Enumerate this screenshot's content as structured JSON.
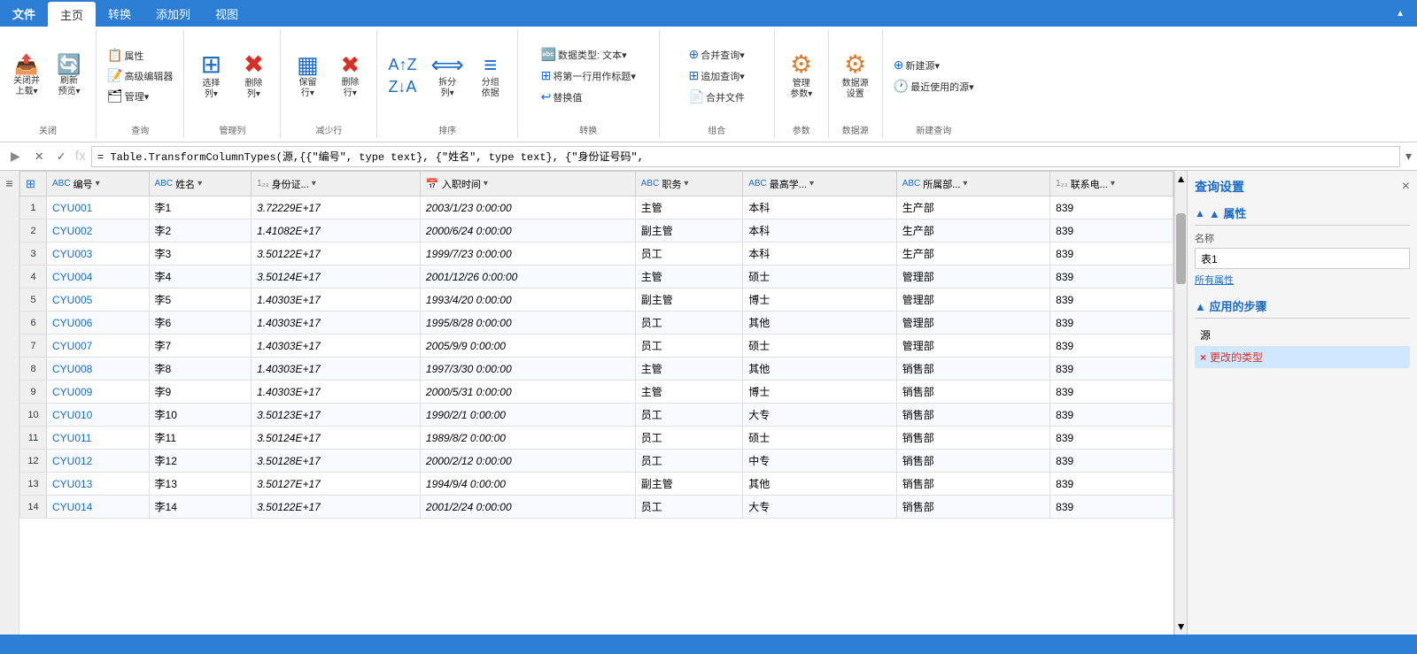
{
  "tabs": {
    "file": "文件",
    "home": "主页",
    "transform": "转换",
    "add_col": "添加列",
    "view": "视图"
  },
  "ribbon": {
    "groups": [
      {
        "name": "close_group",
        "label": "关闭",
        "items": [
          {
            "id": "close_load",
            "icon": "📤",
            "label": "关闭并\n上载▾",
            "type": "big"
          },
          {
            "id": "refresh",
            "icon": "🔄",
            "label": "刷新\n预览▾",
            "type": "big"
          }
        ]
      },
      {
        "name": "query_group",
        "label": "查询",
        "items": [
          {
            "id": "properties",
            "icon": "📋",
            "label": "属性",
            "type": "small"
          },
          {
            "id": "advanced_editor",
            "icon": "📝",
            "label": "高级编辑器",
            "type": "small"
          },
          {
            "id": "manage",
            "icon": "🗂",
            "label": "管理▾",
            "type": "small"
          }
        ]
      },
      {
        "name": "manage_col_group",
        "label": "管理列",
        "items": [
          {
            "id": "select_col",
            "icon": "☑",
            "label": "选择\n列▾",
            "type": "big"
          },
          {
            "id": "delete_col",
            "icon": "✖",
            "label": "删除\n列▾",
            "type": "big"
          }
        ]
      },
      {
        "name": "reduce_row_group",
        "label": "减少行",
        "items": [
          {
            "id": "keep_row",
            "icon": "▦",
            "label": "保留\n行▾",
            "type": "big"
          },
          {
            "id": "remove_row",
            "icon": "✖",
            "label": "删除\n行▾",
            "type": "big"
          }
        ]
      },
      {
        "name": "sort_group",
        "label": "排序",
        "items": [
          {
            "id": "sort_asc",
            "icon": "↑",
            "label": "",
            "type": "sort"
          },
          {
            "id": "sort_desc",
            "icon": "↓",
            "label": "",
            "type": "sort"
          },
          {
            "id": "split_col",
            "icon": "⟺",
            "label": "拆分\n列▾",
            "type": "big"
          },
          {
            "id": "group_by",
            "icon": "≡",
            "label": "分组\n依据",
            "type": "big"
          }
        ]
      },
      {
        "name": "transform_group",
        "label": "转换",
        "items": [
          {
            "id": "data_type",
            "icon": "🔤",
            "label": "数据类型: 文本▾",
            "type": "wide"
          },
          {
            "id": "first_row_header",
            "icon": "⊞",
            "label": "将第一行用作标题▾",
            "type": "wide"
          },
          {
            "id": "replace_value",
            "icon": "↩",
            "label": "替换值",
            "type": "wide"
          }
        ]
      },
      {
        "name": "combine_group",
        "label": "组合",
        "items": [
          {
            "id": "merge_query",
            "icon": "⊕",
            "label": "合并查询▾",
            "type": "wide"
          },
          {
            "id": "append_query",
            "icon": "⊞",
            "label": "追加查询▾",
            "type": "wide"
          },
          {
            "id": "merge_file",
            "icon": "📄",
            "label": "合并文件",
            "type": "wide"
          }
        ]
      },
      {
        "name": "params_group",
        "label": "参数",
        "items": [
          {
            "id": "manage_params",
            "icon": "⚙",
            "label": "管理\n参数▾",
            "type": "big"
          }
        ]
      },
      {
        "name": "datasource_group",
        "label": "数据源",
        "items": [
          {
            "id": "datasource_settings",
            "icon": "⚙",
            "label": "数据源\n设置",
            "type": "big"
          }
        ]
      },
      {
        "name": "new_query_group",
        "label": "新建查询",
        "items": [
          {
            "id": "new_source",
            "icon": "⊕",
            "label": "新建源▾",
            "type": "wide"
          },
          {
            "id": "recent_source",
            "icon": "🕐",
            "label": "最近使用的源▾",
            "type": "wide"
          }
        ]
      }
    ]
  },
  "formula_bar": {
    "cancel_icon": "✕",
    "confirm_icon": "✓",
    "fx_label": "fx",
    "formula": "= Table.TransformColumnTypes(源,{{\"编号\", type text}, {\"姓名\", type text}, {\"身份证号码\","
  },
  "table": {
    "columns": [
      {
        "id": "row_num",
        "label": "",
        "type": ""
      },
      {
        "id": "num",
        "label": "编号",
        "type": "ABC"
      },
      {
        "id": "name",
        "label": "姓名",
        "type": "ABC"
      },
      {
        "id": "id_card",
        "label": "身份证...",
        "type": "123"
      },
      {
        "id": "entry_time",
        "label": "入职时间",
        "type": "CAL"
      },
      {
        "id": "position",
        "label": "职务",
        "type": "ABC"
      },
      {
        "id": "education",
        "label": "最高学...",
        "type": "ABC"
      },
      {
        "id": "department",
        "label": "所属部...",
        "type": "ABC"
      },
      {
        "id": "phone",
        "label": "联系电...",
        "type": "123"
      }
    ],
    "rows": [
      {
        "row": 1,
        "num": "CYU001",
        "name": "李1",
        "id_card": "3.72229E+17",
        "entry_time": "2003/1/23 0:00:00",
        "position": "主管",
        "education": "本科",
        "department": "生产部",
        "phone": "839"
      },
      {
        "row": 2,
        "num": "CYU002",
        "name": "李2",
        "id_card": "1.41082E+17",
        "entry_time": "2000/6/24 0:00:00",
        "position": "副主管",
        "education": "本科",
        "department": "生产部",
        "phone": "839"
      },
      {
        "row": 3,
        "num": "CYU003",
        "name": "李3",
        "id_card": "3.50122E+17",
        "entry_time": "1999/7/23 0:00:00",
        "position": "员工",
        "education": "本科",
        "department": "生产部",
        "phone": "839"
      },
      {
        "row": 4,
        "num": "CYU004",
        "name": "李4",
        "id_card": "3.50124E+17",
        "entry_time": "2001/12/26 0:00:00",
        "position": "主管",
        "education": "硕士",
        "department": "管理部",
        "phone": "839"
      },
      {
        "row": 5,
        "num": "CYU005",
        "name": "李5",
        "id_card": "1.40303E+17",
        "entry_time": "1993/4/20 0:00:00",
        "position": "副主管",
        "education": "博士",
        "department": "管理部",
        "phone": "839"
      },
      {
        "row": 6,
        "num": "CYU006",
        "name": "李6",
        "id_card": "1.40303E+17",
        "entry_time": "1995/8/28 0:00:00",
        "position": "员工",
        "education": "其他",
        "department": "管理部",
        "phone": "839"
      },
      {
        "row": 7,
        "num": "CYU007",
        "name": "李7",
        "id_card": "1.40303E+17",
        "entry_time": "2005/9/9 0:00:00",
        "position": "员工",
        "education": "硕士",
        "department": "管理部",
        "phone": "839"
      },
      {
        "row": 8,
        "num": "CYU008",
        "name": "李8",
        "id_card": "1.40303E+17",
        "entry_time": "1997/3/30 0:00:00",
        "position": "主管",
        "education": "其他",
        "department": "销售部",
        "phone": "839"
      },
      {
        "row": 9,
        "num": "CYU009",
        "name": "李9",
        "id_card": "1.40303E+17",
        "entry_time": "2000/5/31 0:00:00",
        "position": "主管",
        "education": "博士",
        "department": "销售部",
        "phone": "839"
      },
      {
        "row": 10,
        "num": "CYU010",
        "name": "李10",
        "id_card": "3.50123E+17",
        "entry_time": "1990/2/1 0:00:00",
        "position": "员工",
        "education": "大专",
        "department": "销售部",
        "phone": "839"
      },
      {
        "row": 11,
        "num": "CYU011",
        "name": "李11",
        "id_card": "3.50124E+17",
        "entry_time": "1989/8/2 0:00:00",
        "position": "员工",
        "education": "硕士",
        "department": "销售部",
        "phone": "839"
      },
      {
        "row": 12,
        "num": "CYU012",
        "name": "李12",
        "id_card": "3.50128E+17",
        "entry_time": "2000/2/12 0:00:00",
        "position": "员工",
        "education": "中专",
        "department": "销售部",
        "phone": "839"
      },
      {
        "row": 13,
        "num": "CYU013",
        "name": "李13",
        "id_card": "3.50127E+17",
        "entry_time": "1994/9/4 0:00:00",
        "position": "副主管",
        "education": "其他",
        "department": "销售部",
        "phone": "839"
      },
      {
        "row": 14,
        "num": "CYU014",
        "name": "李14",
        "id_card": "3.50122E+17",
        "entry_time": "2001/2/24 0:00:00",
        "position": "员工",
        "education": "大专",
        "department": "销售部",
        "phone": "839"
      }
    ]
  },
  "right_panel": {
    "title": "查询设置",
    "close_icon": "×",
    "properties_label": "▲ 属性",
    "name_label": "名称",
    "name_value": "表1",
    "all_props_link": "所有属性",
    "steps_label": "▲ 应用的步骤",
    "steps": [
      {
        "id": "source",
        "label": "源",
        "active": false,
        "error": false
      },
      {
        "id": "changed_type",
        "label": "更改的类型",
        "active": true,
        "error": true
      }
    ]
  },
  "status_bar": {
    "text": ""
  },
  "colors": {
    "blue": "#1a6cc7",
    "tab_blue": "#2b7ed4",
    "red": "#d93025",
    "orange": "#e07b2c"
  }
}
